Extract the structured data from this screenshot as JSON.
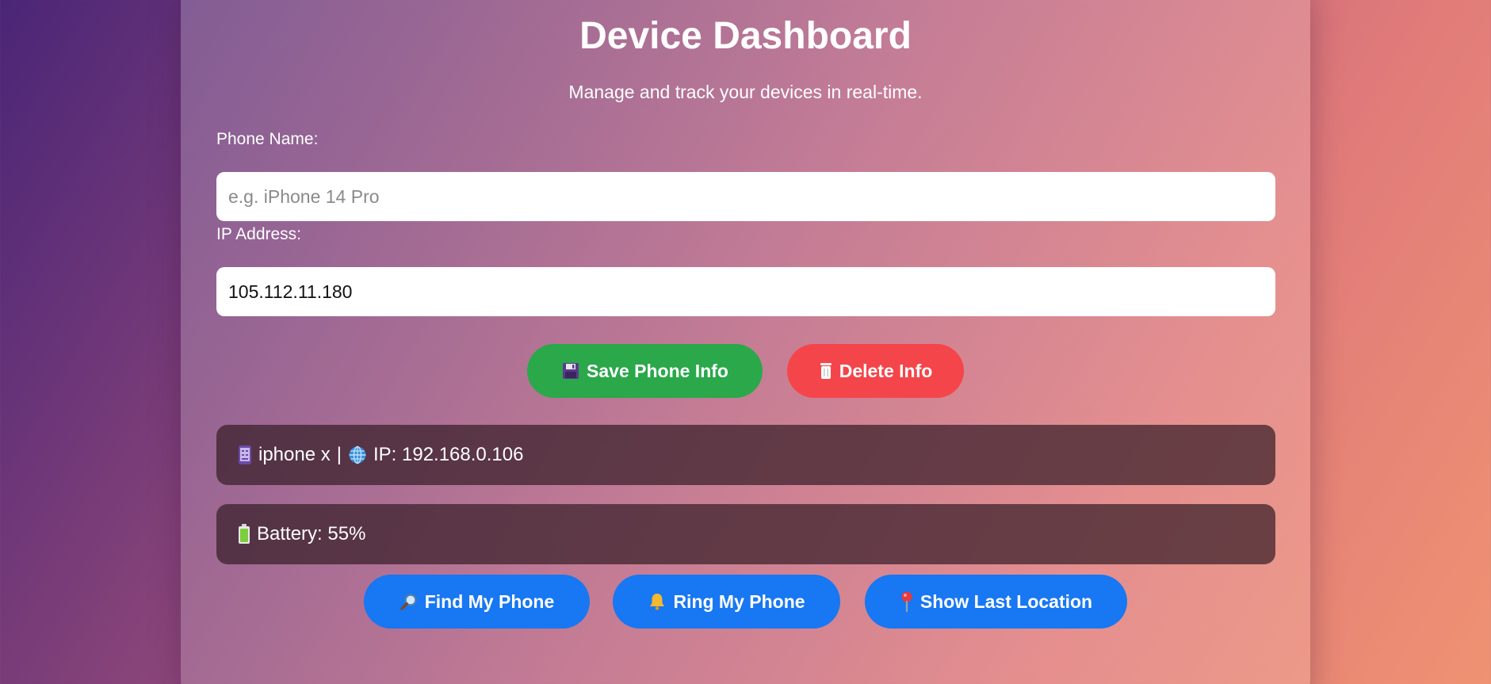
{
  "header": {
    "title": "Device Dashboard",
    "subtitle": "Manage and track your devices in real-time."
  },
  "form": {
    "phone_name_label": "Phone Name:",
    "phone_name_placeholder": "e.g. iPhone 14 Pro",
    "phone_name_value": "",
    "ip_label": "IP Address:",
    "ip_value": "105.112.11.180"
  },
  "actions": {
    "save_label": "Save Phone Info",
    "delete_label": "Delete Info"
  },
  "device": {
    "name": "iphone x",
    "separator": "|",
    "ip_text": "IP: 192.168.0.106",
    "battery_text": "Battery: 55%"
  },
  "tools": {
    "find_label": "Find My Phone",
    "ring_label": "Ring My Phone",
    "location_label": "Show Last Location"
  },
  "icons": {
    "save": "floppy-disk-icon",
    "delete": "trash-icon",
    "phone": "mobile-phone-icon",
    "globe": "globe-icon",
    "battery": "battery-icon",
    "find": "magnifier-icon",
    "ring": "bell-icon",
    "location": "map-pin-icon"
  },
  "colors": {
    "save": "#2aa84a",
    "delete": "#f4464a",
    "primary": "#1877f2"
  }
}
